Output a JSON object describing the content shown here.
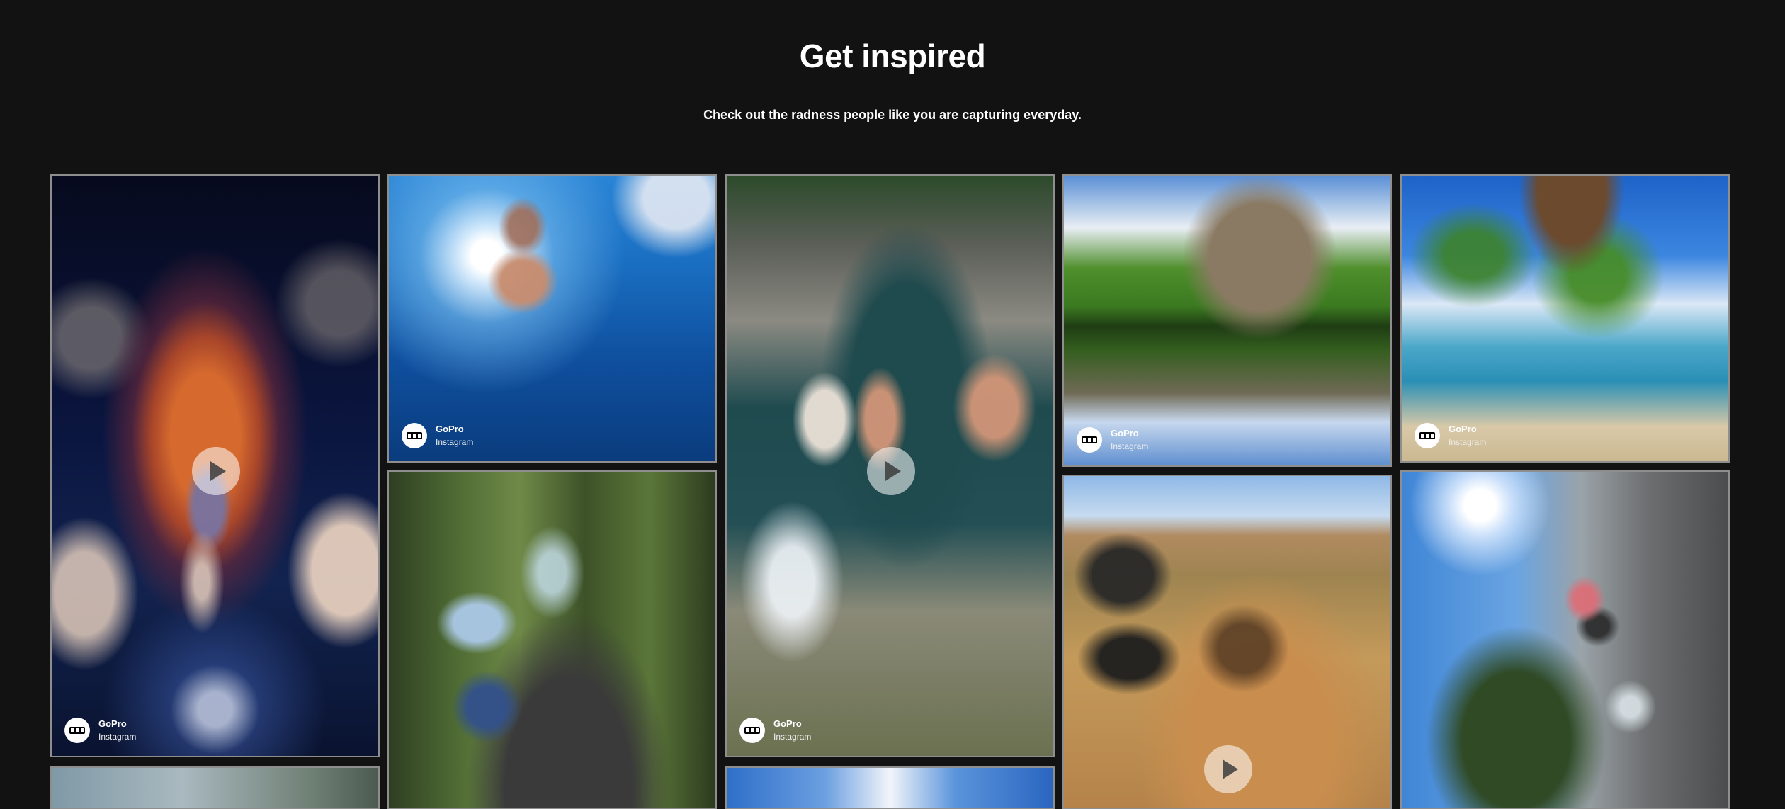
{
  "header": {
    "title": "Get inspired",
    "subtitle": "Check out the radness people like you are capturing everyday."
  },
  "tiles": [
    {
      "scene": "tiny-planet castle sky dive",
      "video": true,
      "brand": "GoPro",
      "platform": "Instagram"
    },
    {
      "scene": "underwater swimmer under sun",
      "video": false,
      "brand": "GoPro",
      "platform": "Instagram"
    },
    {
      "scene": "road skateboarder in forest",
      "video": false
    },
    {
      "scene": "cliff jump over pool",
      "video": true,
      "brand": "GoPro",
      "platform": "Instagram"
    },
    {
      "scene": "mountain lake reflection",
      "video": false,
      "brand": "GoPro",
      "platform": "Instagram"
    },
    {
      "scene": "desert dirt bike",
      "video": true
    },
    {
      "scene": "palm tree beach fisheye",
      "video": false,
      "brand": "GoPro",
      "platform": "Instagram"
    },
    {
      "scene": "waterfall rock climber",
      "video": false
    },
    {
      "scene": "mountain landscape (partial)",
      "video": false
    },
    {
      "scene": "sky (partial)",
      "video": false
    }
  ]
}
